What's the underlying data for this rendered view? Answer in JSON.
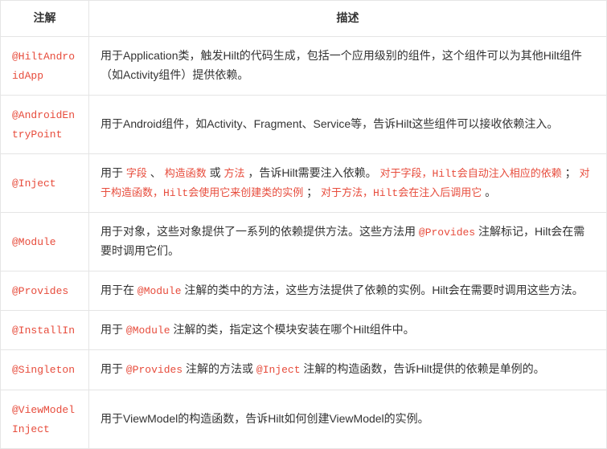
{
  "headers": {
    "annotation": "注解",
    "description": "描述"
  },
  "rows": [
    {
      "annotation": "@HiltAndroidApp",
      "desc": [
        {
          "t": "用于Application类，触发Hilt的代码生成，包括一个应用级别的组件，这个组件可以为其他Hilt组件（如Activity组件）提供依赖。",
          "c": false
        }
      ]
    },
    {
      "annotation": "@AndroidEntryPoint",
      "desc": [
        {
          "t": "用于Android组件，如Activity、Fragment、Service等，告诉Hilt这些组件可以接收依赖注入。",
          "c": false
        }
      ]
    },
    {
      "annotation": "@Inject",
      "desc": [
        {
          "t": "用于 ",
          "c": false
        },
        {
          "t": "字段",
          "c": true
        },
        {
          "t": " 、 ",
          "c": false
        },
        {
          "t": "构造函数",
          "c": true
        },
        {
          "t": " 或 ",
          "c": false
        },
        {
          "t": "方法",
          "c": true
        },
        {
          "t": " ，告诉Hilt需要注入依赖。 ",
          "c": false
        },
        {
          "t": "对于字段，Hilt会自动注入相应的依赖",
          "c": true
        },
        {
          "t": " ； ",
          "c": false
        },
        {
          "t": "对于构造函数，Hilt会使用它来创建类的实例",
          "c": true
        },
        {
          "t": " ； ",
          "c": false
        },
        {
          "t": "对于方法，Hilt会在注入后调用它",
          "c": true
        },
        {
          "t": " 。",
          "c": false
        }
      ]
    },
    {
      "annotation": "@Module",
      "desc": [
        {
          "t": "用于对象，这些对象提供了一系列的依赖提供方法。这些方法用 ",
          "c": false
        },
        {
          "t": "@Provides",
          "c": true
        },
        {
          "t": " 注解标记，Hilt会在需要时调用它们。",
          "c": false
        }
      ]
    },
    {
      "annotation": "@Provides",
      "desc": [
        {
          "t": "用于在 ",
          "c": false
        },
        {
          "t": "@Module",
          "c": true
        },
        {
          "t": " 注解的类中的方法，这些方法提供了依赖的实例。Hilt会在需要时调用这些方法。",
          "c": false
        }
      ]
    },
    {
      "annotation": "@InstallIn",
      "desc": [
        {
          "t": "用于 ",
          "c": false
        },
        {
          "t": "@Module",
          "c": true
        },
        {
          "t": " 注解的类，指定这个模块安装在哪个Hilt组件中。",
          "c": false
        }
      ]
    },
    {
      "annotation": "@Singleton",
      "desc": [
        {
          "t": "用于 ",
          "c": false
        },
        {
          "t": "@Provides",
          "c": true
        },
        {
          "t": " 注解的方法或 ",
          "c": false
        },
        {
          "t": "@Inject",
          "c": true
        },
        {
          "t": " 注解的构造函数，告诉Hilt提供的依赖是单例的。",
          "c": false
        }
      ]
    },
    {
      "annotation": "@ViewModelInject",
      "desc": [
        {
          "t": "用于ViewModel的构造函数，告诉Hilt如何创建ViewModel的实例。",
          "c": false
        }
      ]
    }
  ]
}
